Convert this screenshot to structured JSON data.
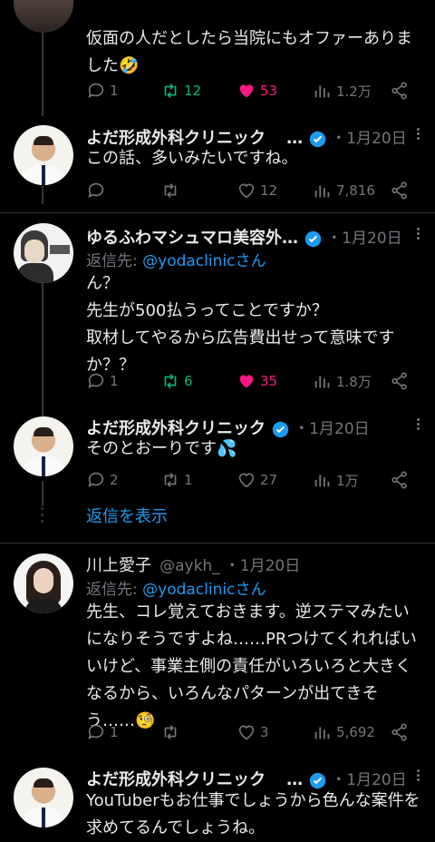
{
  "tweets": [
    {
      "text": "仮面の人だとしたら当院にもオファーありました🤣",
      "replies": "1",
      "retweets": "12",
      "likes": "53",
      "views": "1.2万"
    },
    {
      "name": "よだ形成外科クリニック",
      "ellipsis": "…",
      "date": "・1月20日",
      "text": "この話、多いみたいですね。",
      "replies": "",
      "retweets": "",
      "likes": "12",
      "views": "7,816"
    },
    {
      "name": "ゆるふわマシュマロ美容外…",
      "date": "・1月20日",
      "reply_prefix": "返信先: ",
      "reply_handle": "@yodaclinic",
      "reply_suffix": "さん",
      "text": "ん？\n先生が500払うってことですか？\n取材してやるから広告費出せって意味ですか？？",
      "replies": "1",
      "retweets": "6",
      "likes": "35",
      "views": "1.8万"
    },
    {
      "name": "よだ形成外科クリニック",
      "date": "・1月20日",
      "text": "そのとおーりです💦",
      "replies": "2",
      "retweets": "1",
      "likes": "27",
      "views": "1万"
    },
    {
      "name": "川上愛子",
      "handle": "@aykh_",
      "date": "・1月20日",
      "reply_prefix": "返信先: ",
      "reply_handle": "@yodaclinic",
      "reply_suffix": "さん",
      "text": "先生、コレ覚えておきます。逆ステマみたいになりそうですよね……PRつけてくれればいいけど、事業主側の責任がいろいろと大きくなるから、いろんなパターンが出てきそう……🧐",
      "replies": "1",
      "retweets": "",
      "likes": "3",
      "views": "5,692"
    },
    {
      "name": "よだ形成外科クリニック",
      "ellipsis": "…",
      "date": "・1月20日",
      "text": "YouTuberもお仕事でしょうから色んな案件を求めてるんでしょうね。"
    }
  ],
  "show_replies": "返信を表示",
  "colors": {
    "accent": "#1d9bf0",
    "retweet": "#00ba7c",
    "like": "#f91880",
    "muted": "#71767b"
  }
}
